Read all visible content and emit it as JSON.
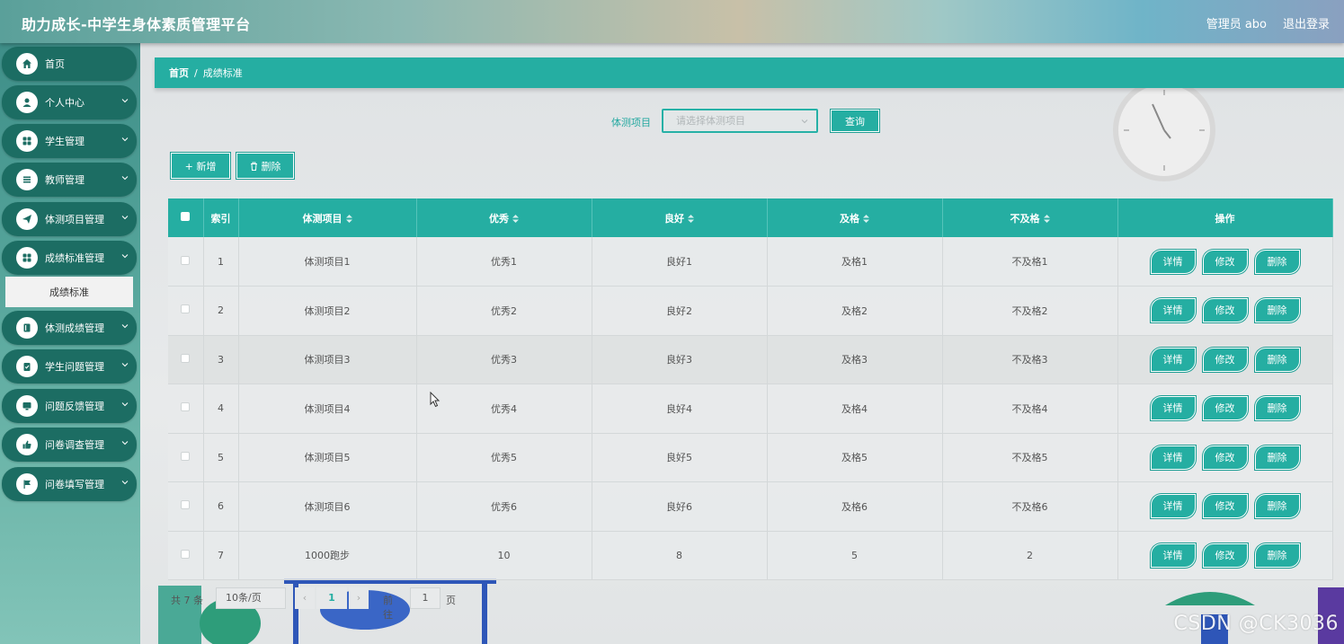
{
  "header": {
    "title": "助力成长-中学生身体素质管理平台",
    "user": "管理员 abo",
    "logout": "退出登录"
  },
  "sidebar": {
    "items": [
      {
        "label": "首页",
        "icon": "home-icon"
      },
      {
        "label": "个人中心",
        "icon": "user-icon"
      },
      {
        "label": "学生管理",
        "icon": "grid-icon"
      },
      {
        "label": "教师管理",
        "icon": "list-icon"
      },
      {
        "label": "体测项目管理",
        "icon": "send-icon"
      },
      {
        "label": "成绩标准管理",
        "icon": "grid-icon"
      },
      {
        "label": "体测成绩管理",
        "icon": "book-icon"
      },
      {
        "label": "学生问题管理",
        "icon": "clipboard-icon"
      },
      {
        "label": "问题反馈管理",
        "icon": "monitor-icon"
      },
      {
        "label": "问卷调查管理",
        "icon": "thumb-icon"
      },
      {
        "label": "问卷填写管理",
        "icon": "flag-icon"
      }
    ],
    "active_sub": "成绩标准"
  },
  "breadcrumb": {
    "home": "首页",
    "separator": "/",
    "current": "成绩标准"
  },
  "search": {
    "label": "体测项目",
    "placeholder": "请选择体测项目",
    "button": "查询"
  },
  "toolbar": {
    "add": "+ 新增",
    "delete": "删除"
  },
  "table": {
    "columns": [
      "索引",
      "体测项目",
      "优秀",
      "良好",
      "及格",
      "不及格",
      "操作"
    ],
    "rows": [
      {
        "index": "1",
        "item": "体测项目1",
        "excellent": "优秀1",
        "good": "良好1",
        "pass": "及格1",
        "fail": "不及格1"
      },
      {
        "index": "2",
        "item": "体测项目2",
        "excellent": "优秀2",
        "good": "良好2",
        "pass": "及格2",
        "fail": "不及格2"
      },
      {
        "index": "3",
        "item": "体测项目3",
        "excellent": "优秀3",
        "good": "良好3",
        "pass": "及格3",
        "fail": "不及格3"
      },
      {
        "index": "4",
        "item": "体测项目4",
        "excellent": "优秀4",
        "good": "良好4",
        "pass": "及格4",
        "fail": "不及格4"
      },
      {
        "index": "5",
        "item": "体测项目5",
        "excellent": "优秀5",
        "good": "良好5",
        "pass": "及格5",
        "fail": "不及格5"
      },
      {
        "index": "6",
        "item": "体测项目6",
        "excellent": "优秀6",
        "good": "良好6",
        "pass": "及格6",
        "fail": "不及格6"
      },
      {
        "index": "7",
        "item": "1000跑步",
        "excellent": "10",
        "good": "8",
        "pass": "5",
        "fail": "2"
      }
    ],
    "actions": {
      "detail": "详情",
      "edit": "修改",
      "delete": "删除"
    }
  },
  "pagination": {
    "total": "共 7 条",
    "page_size": "10条/页",
    "prev": "‹",
    "current": "1",
    "next": "›",
    "goto_label": "前往",
    "goto_value": "1",
    "page_unit": "页"
  },
  "watermark": "CSDN @CK3036",
  "colors": {
    "accent": "#25aea2",
    "sidebar_item": "#1c6d63"
  }
}
